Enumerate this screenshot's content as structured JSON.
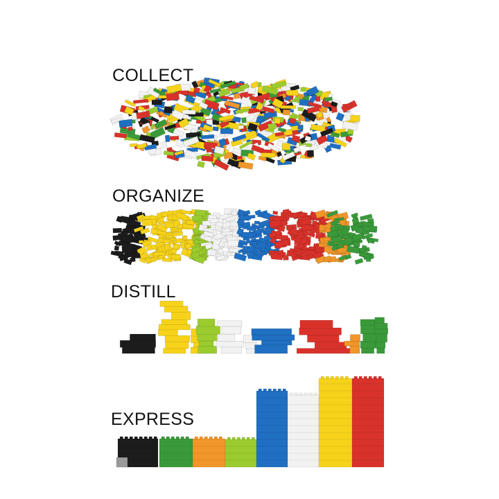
{
  "labels": {
    "collect": "COLLECT",
    "organize": "ORGANIZE",
    "distill": "DISTILL",
    "express": "EXPRESS"
  },
  "colors": {
    "black": "#1c1c1c",
    "yellow": "#f6d31a",
    "lime": "#9bcc2f",
    "white": "#f2f2f2",
    "blue": "#1f6fc2",
    "red": "#d9322a",
    "orange": "#f0962a",
    "green": "#3a9a3a",
    "gray": "#9a9a9a"
  },
  "stages": [
    {
      "name": "collect",
      "depiction": "mixed-brick-pile"
    },
    {
      "name": "organize",
      "depiction": "bricks-sorted-by-color"
    },
    {
      "name": "distill",
      "depiction": "sorted-bricks-stacked"
    },
    {
      "name": "express",
      "depiction": "color-bars-by-amount"
    }
  ]
}
